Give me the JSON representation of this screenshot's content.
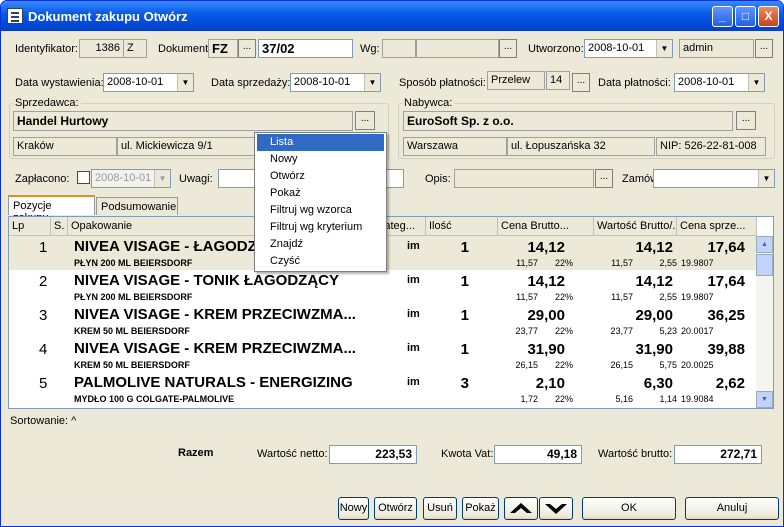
{
  "window": {
    "title": "Dokument zakupu Otwórz",
    "minimize": "_",
    "maximize": "□",
    "close": "X"
  },
  "header": {
    "identyfikator_label": "Identyfikator:",
    "identyfikator_value": "1386",
    "identyfikator_suffix": "Z",
    "dokument_label": "Dokument:",
    "dokument_type": "FZ",
    "dokument_number": "37/02",
    "wg_label": "Wg:",
    "wg_value": "",
    "wg_value2": "",
    "utworzono_label": "Utworzono:",
    "utworzono_value": "2008-10-01",
    "user_value": "admin"
  },
  "dates": {
    "wystawienia_label": "Data wystawienia:",
    "wystawienia_value": "2008-10-01",
    "sprzedazy_label": "Data sprzedaży:",
    "sprzedazy_value": "2008-10-01",
    "sposob_label": "Sposób płatności:",
    "sposob_value": "Przelew",
    "sposob_days": "14",
    "platnosci_label": "Data płatności:",
    "platnosci_value": "2008-10-01"
  },
  "seller": {
    "group_label": "Sprzedawca:",
    "name": "Handel Hurtowy",
    "city": "Kraków",
    "street": "ul. Mickiewicza 9/1"
  },
  "buyer": {
    "group_label": "Nabywca:",
    "name": "EuroSoft Sp. z o.o.",
    "city": "Warszawa",
    "street": "ul. Łopuszańska 32",
    "nip": "NIP: 526-22-81-008"
  },
  "payment": {
    "zaplacono_label": "Zapłacono:",
    "zaplacono_date": "2008-10-01",
    "uwagi_label": "Uwagi:",
    "opis_label": "Opis:",
    "zamowienie_label": "Zamówienie"
  },
  "tabs": [
    {
      "label": "Pozycje zakupu"
    },
    {
      "label": "Podsumowanie"
    }
  ],
  "grid": {
    "columns": [
      "Lp",
      "S.",
      "Opakowanie",
      "Kateg...",
      "Ilość",
      "Cena Brutto...",
      "Wartość Brutto/...",
      "Cena sprze..."
    ],
    "rows": [
      {
        "lp": "1",
        "name": "NIVEA VISAGE - ŁAGODZ",
        "unit": "im",
        "qty": "1",
        "price": "14,12",
        "value": "14,12",
        "sale": "17,64",
        "sub": "PŁYN 200 ML BEIERSDORF",
        "netto": "11,57",
        "vat": "22%",
        "vnetto": "11,57",
        "vvat": "2,55",
        "code": "19.9807"
      },
      {
        "lp": "2",
        "name": "NIVEA VISAGE - TONIK ŁAGODZĄCY",
        "unit": "im",
        "qty": "1",
        "price": "14,12",
        "value": "14,12",
        "sale": "17,64",
        "sub": "PŁYN 200 ML BEIERSDORF",
        "netto": "11,57",
        "vat": "22%",
        "vnetto": "11,57",
        "vvat": "2,55",
        "code": "19.9807"
      },
      {
        "lp": "3",
        "name": "NIVEA VISAGE - KREM PRZECIWZMA...",
        "unit": "im",
        "qty": "1",
        "price": "29,00",
        "value": "29,00",
        "sale": "36,25",
        "sub": "KREM 50 ML BEIERSDORF",
        "netto": "23,77",
        "vat": "22%",
        "vnetto": "23,77",
        "vvat": "5,23",
        "code": "20.0017"
      },
      {
        "lp": "4",
        "name": "NIVEA VISAGE - KREM PRZECIWZMA...",
        "unit": "im",
        "qty": "1",
        "price": "31,90",
        "value": "31,90",
        "sale": "39,88",
        "sub": "KREM 50 ML BEIERSDORF",
        "netto": "26,15",
        "vat": "22%",
        "vnetto": "26,15",
        "vvat": "5,75",
        "code": "20.0025"
      },
      {
        "lp": "5",
        "name": "PALMOLIVE NATURALS - ENERGIZING",
        "unit": "im",
        "qty": "3",
        "price": "2,10",
        "value": "6,30",
        "sale": "2,62",
        "sub": "MYDŁO 100 G COLGATE-PALMOLIVE",
        "netto": "1,72",
        "vat": "22%",
        "vnetto": "5,16",
        "vvat": "1,14",
        "code": "19.9084"
      }
    ]
  },
  "context_menu": {
    "items": [
      "Lista",
      "Nowy",
      "Otwórz",
      "Pokaż",
      "Filtruj wg wzorca",
      "Filtruj wg kryterium",
      "Znajdź",
      "Czyść"
    ]
  },
  "sort": {
    "label": "Sortowanie: ^"
  },
  "totals": {
    "razem": "Razem",
    "netto_label": "Wartość netto:",
    "netto": "223,53",
    "vat_label": "Kwota Vat:",
    "vat": "49,18",
    "brutto_label": "Wartość brutto:",
    "brutto": "272,71"
  },
  "buttons": {
    "nowy": "Nowy",
    "otworz": "Otwórz",
    "usun": "Usuń",
    "pokaz": "Pokaż",
    "ok": "OK",
    "anuluj": "Anuluj",
    "dots": "..."
  }
}
